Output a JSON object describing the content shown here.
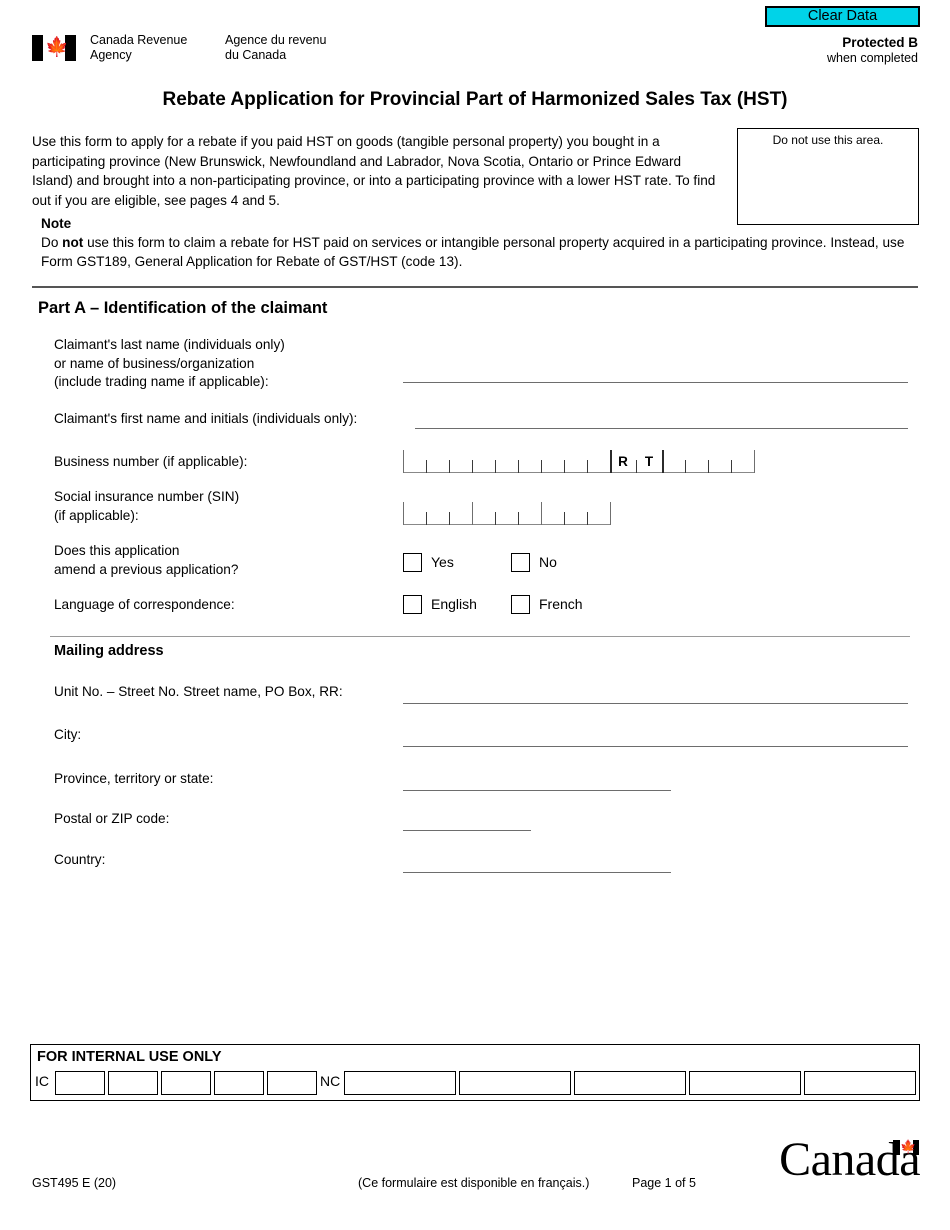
{
  "toolbar": {
    "clear_data_label": "Clear Data",
    "clear_data_color": "#00d3e8"
  },
  "header": {
    "agency_en": "Canada Revenue\nAgency",
    "agency_fr": "Agence du revenu\ndu Canada",
    "protected_main": "Protected B",
    "protected_sub": "when completed",
    "flag_icon": "canada-flag-icon"
  },
  "title": "Rebate Application for Provincial Part of Harmonized Sales Tax (HST)",
  "intro": {
    "paragraph": "Use this form to apply for a rebate if you paid HST on goods (tangible personal property) you bought in a participating province (New Brunswick, Newfoundland and Labrador, Nova Scotia, Ontario or Prince Edward Island) and brought into a non-participating province, or into a participating province with a lower HST rate. To find out if you are eligible, see pages 4 and 5."
  },
  "do_not_use": {
    "label": "Do not use this area."
  },
  "note": {
    "title": "Note",
    "text_part1": "Do ",
    "text_bold": "not",
    "text_part2": " use this form to claim a rebate for HST paid on services or intangible personal property acquired in a participating province. Instead, use Form GST189, General Application for Rebate of GST/HST (code 13)."
  },
  "part_a": {
    "heading": "Part A – Identification of the claimant",
    "fields": {
      "last_name_label": "Claimant's last name (individuals only)\nor name of business/organization\n(include trading name if applicable):",
      "last_name_value": "",
      "first_name_label": "Claimant's first name and initials (individuals only):",
      "first_name_value": "",
      "business_number_label": "Business number (if applicable):",
      "business_number_rt_r": "R",
      "business_number_rt_t": "T",
      "sin_label": "Social insurance number (SIN)\n(if applicable):",
      "amend_label": "Does this application\namend a previous application?",
      "amend_yes": "Yes",
      "amend_no": "No",
      "language_label": "Language of correspondence:",
      "language_english": "English",
      "language_french": "French"
    },
    "mailing_address": {
      "heading": "Mailing address",
      "street_label": "Unit No. – Street No. Street name, PO Box, RR:",
      "street_value": "",
      "city_label": "City:",
      "city_value": "",
      "province_label": "Province, territory or state:",
      "province_value": "",
      "postal_label": "Postal or ZIP code:",
      "postal_value": "",
      "country_label": "Country:",
      "country_value": ""
    }
  },
  "internal_use": {
    "title": "FOR INTERNAL USE ONLY",
    "ic_label": "IC",
    "nc_label": "NC"
  },
  "footer": {
    "form_code": "GST495 E (20)",
    "french_note": "(Ce formulaire est disponible en français.)",
    "page_number": "Page 1 of 5",
    "wordmark": "Canada"
  }
}
